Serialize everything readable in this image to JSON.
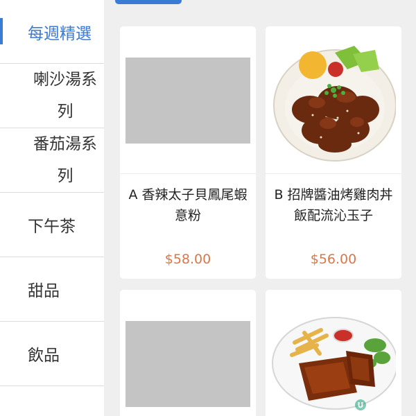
{
  "sidebar": {
    "categories": [
      {
        "label": "每週精選",
        "active": true
      },
      {
        "label": "喇沙湯系列",
        "active": false
      },
      {
        "label": "番茄湯系列",
        "active": false
      },
      {
        "label": "下午茶",
        "active": false
      },
      {
        "label": "甜品",
        "active": false
      },
      {
        "label": "飲品",
        "active": false
      }
    ]
  },
  "products": [
    {
      "name": "A 香辣太子貝鳳尾蝦意粉",
      "price": "$58.00",
      "image": "placeholder"
    },
    {
      "name": "B 招牌醬油烤雞肉丼飯配流沁玉子",
      "price": "$56.00",
      "image": "chicken-rice-bowl"
    },
    {
      "name": "",
      "price": "",
      "image": "placeholder"
    },
    {
      "name": "",
      "price": "",
      "image": "pork-ribs-fries-plate"
    }
  ],
  "colors": {
    "accent": "#3a7bd5",
    "price": "#d9774a",
    "placeholder": "#c4c4c4",
    "content_bg": "#efefef"
  }
}
